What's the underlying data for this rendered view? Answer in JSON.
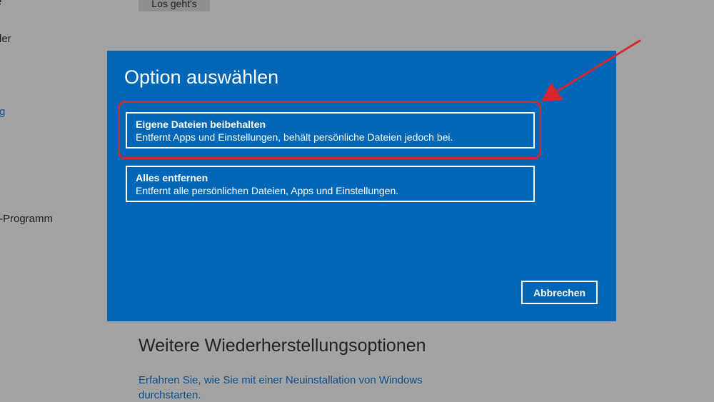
{
  "background": {
    "top_button_label": "Los geht's",
    "sidebar_fragments": [
      "e",
      "ler",
      "g",
      "-Programm"
    ],
    "section_heading": "Weitere Wiederherstellungsoptionen",
    "link_text": "Erfahren Sie, wie Sie mit einer Neuinstallation von Windows durchstarten."
  },
  "dialog": {
    "title": "Option auswählen",
    "options": [
      {
        "title": "Eigene Dateien beibehalten",
        "description": "Entfernt Apps und Einstellungen, behält persönliche Dateien jedoch bei."
      },
      {
        "title": "Alles entfernen",
        "description": "Entfernt alle persönlichen Dateien, Apps und Einstellungen."
      }
    ],
    "cancel_label": "Abbrechen"
  },
  "colors": {
    "dialog_background": "#0067b8",
    "annotation": "#d9262e",
    "dimmed_background": "#a3a3a3"
  }
}
